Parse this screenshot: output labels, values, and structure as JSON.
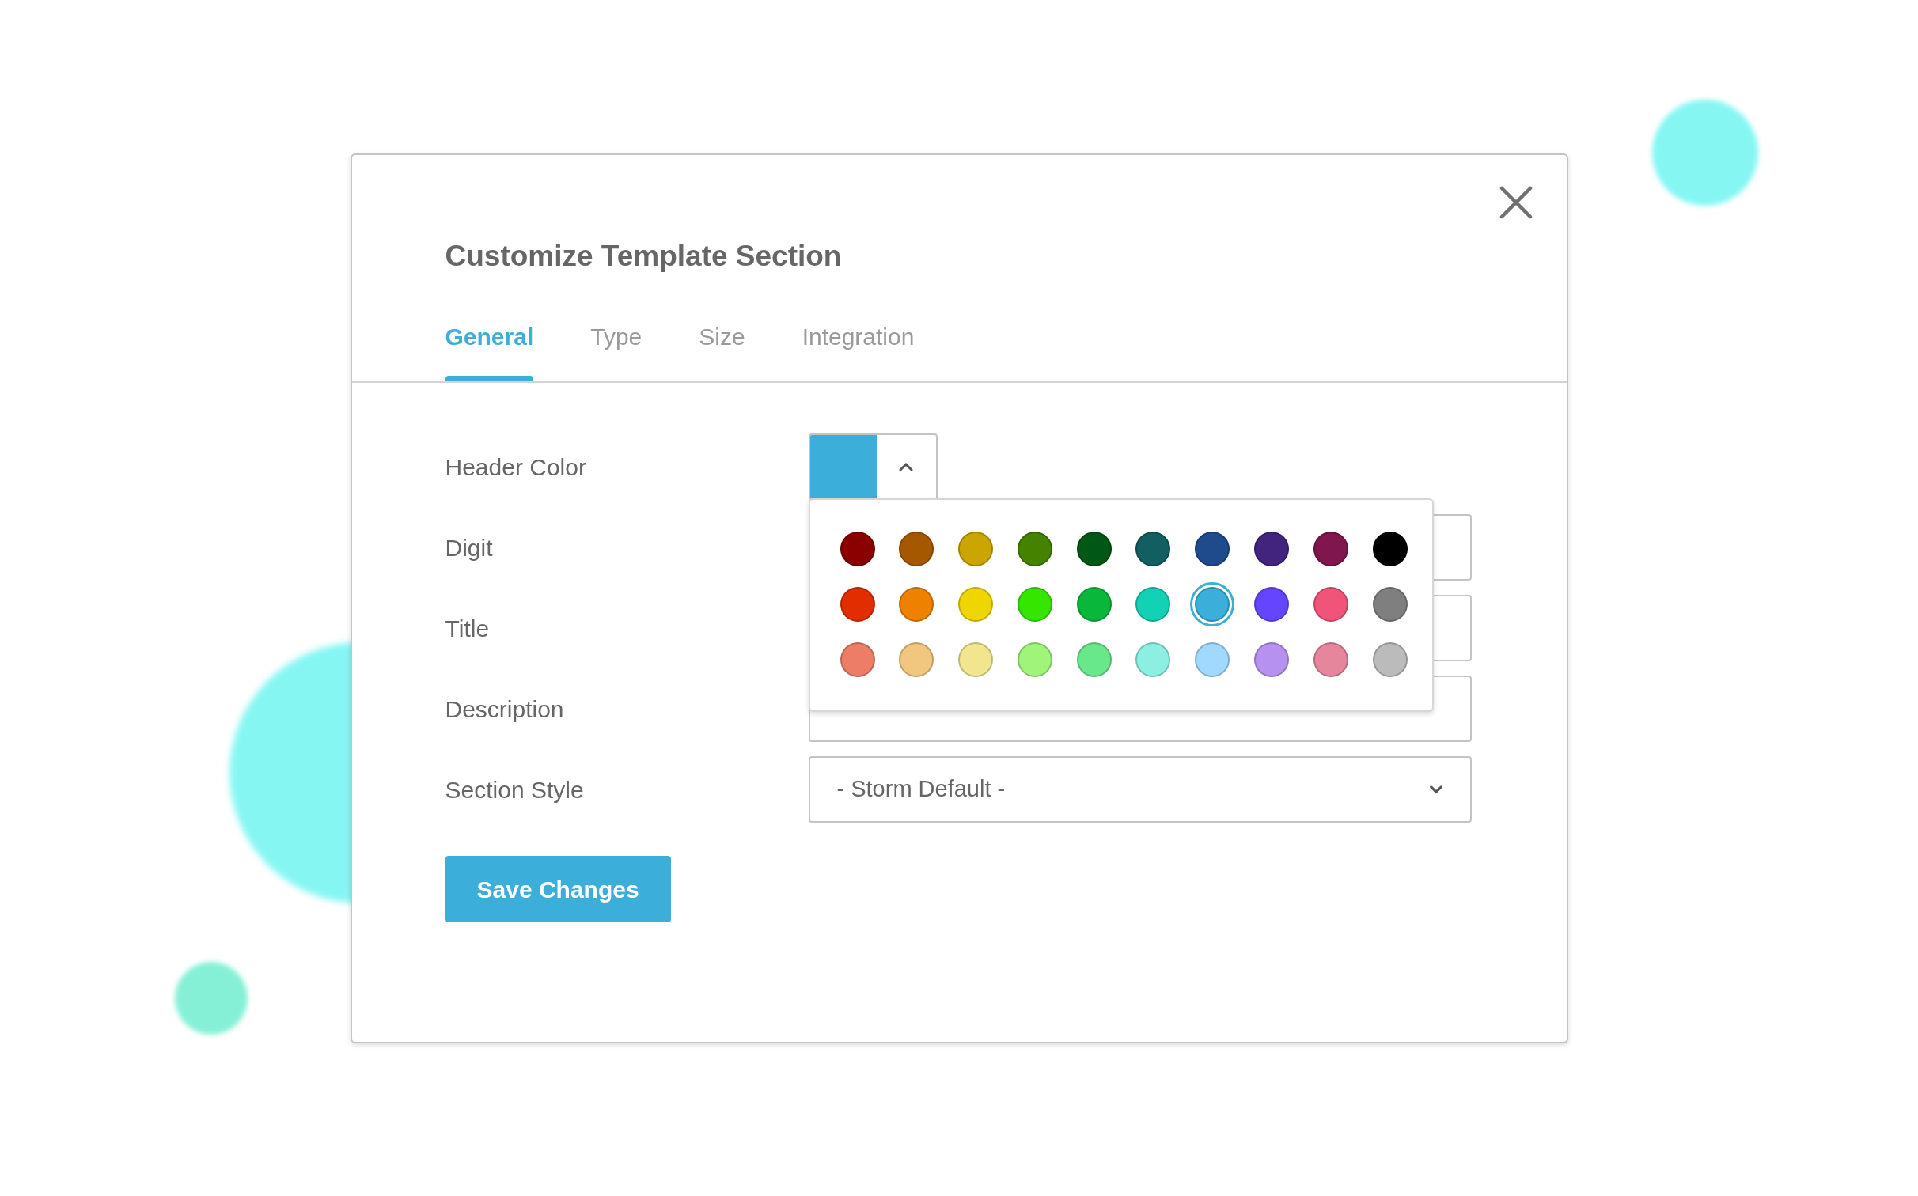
{
  "dialog": {
    "title": "Customize Template Section"
  },
  "tabs": [
    {
      "label": "General",
      "selected": true
    },
    {
      "label": "Type",
      "selected": false
    },
    {
      "label": "Size",
      "selected": false
    },
    {
      "label": "Integration",
      "selected": false
    }
  ],
  "form": {
    "header_color": {
      "label": "Header Color",
      "palette_open": true
    },
    "fields": [
      {
        "label": "Digit",
        "kind": "text"
      },
      {
        "label": "Title",
        "kind": "text"
      },
      {
        "label": "Description",
        "kind": "text"
      },
      {
        "label": "Section Style",
        "kind": "select",
        "value": "- Storm Default -"
      }
    ]
  },
  "palette": [
    {
      "color": "#8b0000",
      "selected": false
    },
    {
      "color": "#a65800",
      "selected": false
    },
    {
      "color": "#cca600",
      "selected": false
    },
    {
      "color": "#448200",
      "selected": false
    },
    {
      "color": "#005716",
      "selected": false
    },
    {
      "color": "#125e61",
      "selected": false
    },
    {
      "color": "#1f4a8c",
      "selected": false
    },
    {
      "color": "#42247f",
      "selected": false
    },
    {
      "color": "#7f164e",
      "selected": false
    },
    {
      "color": "#000000",
      "selected": false
    },
    {
      "color": "#e22d00",
      "selected": false
    },
    {
      "color": "#ef8100",
      "selected": false
    },
    {
      "color": "#efd600",
      "selected": false
    },
    {
      "color": "#35e700",
      "selected": false
    },
    {
      "color": "#09b83a",
      "selected": false
    },
    {
      "color": "#12d1b5",
      "selected": false
    },
    {
      "color": "#3baed9",
      "selected": true
    },
    {
      "color": "#6545fd",
      "selected": false
    },
    {
      "color": "#f05478",
      "selected": false
    },
    {
      "color": "#7f7f7f",
      "selected": false
    },
    {
      "color": "#ed7d67",
      "selected": false
    },
    {
      "color": "#f1c67e",
      "selected": false
    },
    {
      "color": "#f1e68e",
      "selected": false
    },
    {
      "color": "#a1f47a",
      "selected": false
    },
    {
      "color": "#68e88a",
      "selected": false
    },
    {
      "color": "#8bf0e1",
      "selected": false
    },
    {
      "color": "#a1d9fe",
      "selected": false
    },
    {
      "color": "#b791ef",
      "selected": false
    },
    {
      "color": "#e5869d",
      "selected": false
    },
    {
      "color": "#bbbbbb",
      "selected": false
    }
  ],
  "save_button": {
    "label": "Save Changes"
  }
}
